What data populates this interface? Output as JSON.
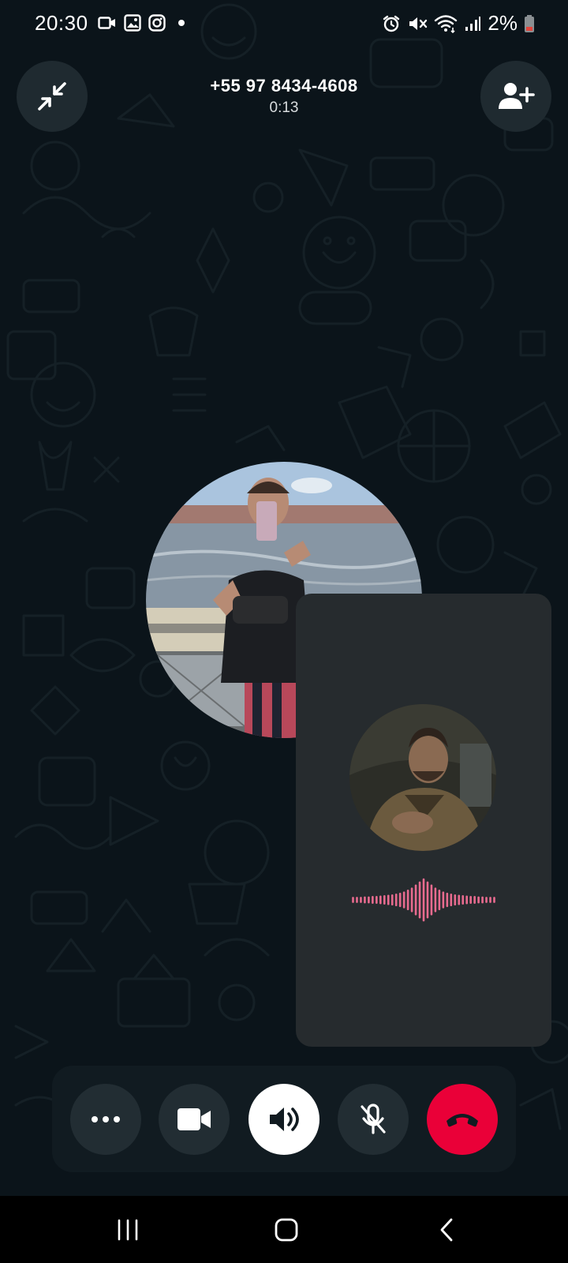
{
  "status_bar": {
    "time": "20:30",
    "battery_percent": "2%",
    "left_icons": [
      "video-recorder-icon",
      "gallery-icon",
      "instagram-icon",
      "notification-dot-icon"
    ],
    "right_icons": [
      "alarm-icon",
      "mute-icon",
      "wifi-icon",
      "signal-icon",
      "battery-low-icon"
    ]
  },
  "call": {
    "number": "+55 97 8434-4608",
    "duration": "0:13"
  },
  "header": {
    "left_icon": "minimize-icon",
    "right_icon": "add-participant-icon"
  },
  "controls": [
    {
      "name": "more-options",
      "icon": "ellipsis-icon"
    },
    {
      "name": "video",
      "icon": "video-camera-icon"
    },
    {
      "name": "speaker",
      "icon": "speaker-icon",
      "active": true
    },
    {
      "name": "mute",
      "icon": "microphone-off-icon"
    },
    {
      "name": "end-call",
      "icon": "phone-hangup-icon"
    }
  ],
  "nav": [
    "recents-icon",
    "home-icon",
    "back-icon"
  ],
  "colors": {
    "background": "#0b141a",
    "button_bg": "#222d33",
    "end_call": "#ea0038",
    "voice_wave": "#e86b8f",
    "pip_bg": "#262b2e"
  },
  "voice_activity_levels": [
    0.1,
    0.1,
    0.1,
    0.12,
    0.12,
    0.14,
    0.14,
    0.16,
    0.18,
    0.2,
    0.22,
    0.26,
    0.3,
    0.36,
    0.45,
    0.55,
    0.7,
    0.85,
    1.0,
    0.85,
    0.7,
    0.55,
    0.45,
    0.36,
    0.3,
    0.26,
    0.22,
    0.2,
    0.18,
    0.16,
    0.14,
    0.14,
    0.12,
    0.12,
    0.1,
    0.1,
    0.1
  ]
}
